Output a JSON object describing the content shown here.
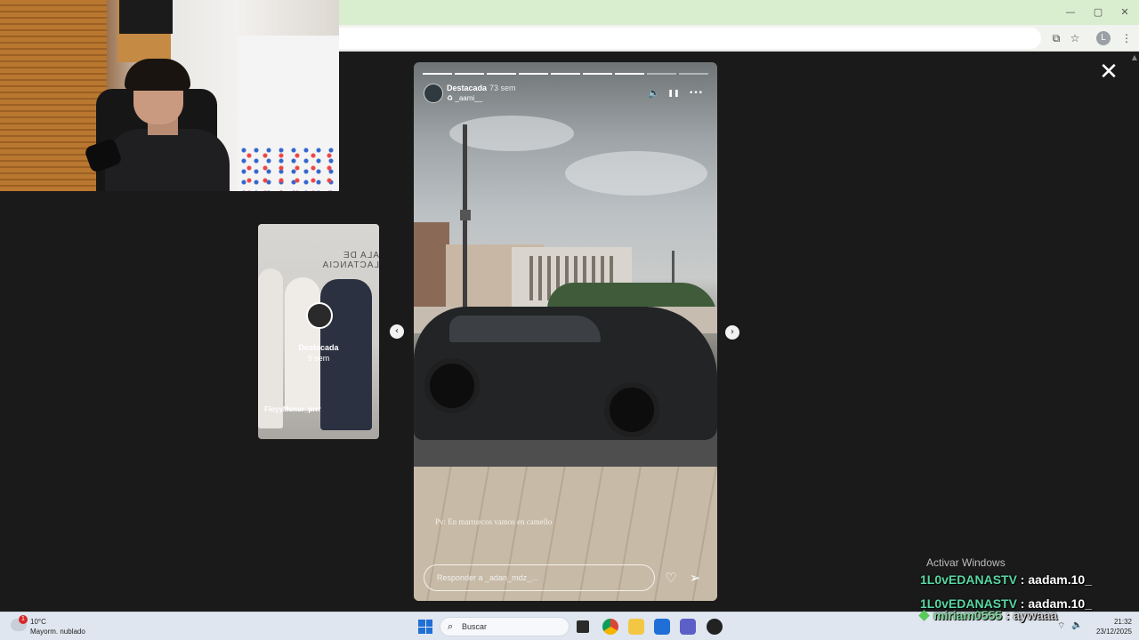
{
  "window": {
    "minimize": "—",
    "maximize": "▢",
    "close": "✕"
  },
  "browser": {
    "install_icon": "install-app-icon",
    "star_icon": "bookmark-star-icon",
    "profile_initial": "L",
    "menu": "⋮"
  },
  "viewer": {
    "close": "✕",
    "prev": "‹",
    "next": "›"
  },
  "preview_card": {
    "title": "Destacada",
    "age": "9 sem",
    "username": "FloyyMenor_prrr",
    "wall_text": "ALA DE LACTANCIA"
  },
  "story": {
    "progress_segments": 9,
    "progress_done": 7,
    "username": "Destacada",
    "age": "73 sem",
    "subtitle": "♻ _aami__",
    "caption": "Pv: En marruecos vamos en camello",
    "reply_placeholder": "Responder a _adan_mdz_...",
    "controls": {
      "mute": "🔈",
      "pause": "❚❚",
      "more": "•••"
    },
    "like": "♡",
    "share": "➢"
  },
  "overlay": {
    "activate_windows": "Activar Windows",
    "chat": [
      {
        "name": "1L0vEDANASTV",
        "message": "aadam.10_"
      },
      {
        "name": "1L0vEDANASTV",
        "message": "aadam.10_"
      },
      {
        "name": "miriam0555",
        "message": "aywaaa"
      }
    ]
  },
  "taskbar": {
    "weather_badge": "1",
    "temperature": "10°C",
    "condition": "Mayorm. nublado",
    "search_placeholder": "Buscar",
    "time": "21:32",
    "date": "23/12/2025",
    "colors": {
      "start": "#1f6fd6",
      "accent_chat": "#59d6a4"
    }
  }
}
